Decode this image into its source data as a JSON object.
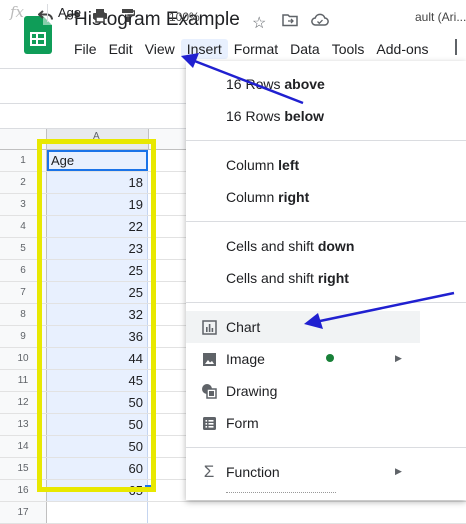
{
  "header": {
    "title": "Histogram Example",
    "menu": [
      "File",
      "Edit",
      "View",
      "Insert",
      "Format",
      "Data",
      "Tools",
      "Add-ons"
    ]
  },
  "toolbar": {
    "zoom": "100%",
    "font": "ault (Ari..."
  },
  "formula_bar": {
    "fx": "fx",
    "value": "Age"
  },
  "grid": {
    "column_header": "A",
    "rows": [
      {
        "n": "1",
        "v": "Age"
      },
      {
        "n": "2",
        "v": "18"
      },
      {
        "n": "3",
        "v": "19"
      },
      {
        "n": "4",
        "v": "22"
      },
      {
        "n": "5",
        "v": "23"
      },
      {
        "n": "6",
        "v": "25"
      },
      {
        "n": "7",
        "v": "25"
      },
      {
        "n": "8",
        "v": "32"
      },
      {
        "n": "9",
        "v": "36"
      },
      {
        "n": "10",
        "v": "44"
      },
      {
        "n": "11",
        "v": "45"
      },
      {
        "n": "12",
        "v": "50"
      },
      {
        "n": "13",
        "v": "50"
      },
      {
        "n": "14",
        "v": "50"
      },
      {
        "n": "15",
        "v": "60"
      },
      {
        "n": "16",
        "v": "65"
      },
      {
        "n": "17",
        "v": ""
      }
    ]
  },
  "insert_menu": {
    "rows_above": {
      "pre": "16 Rows ",
      "bold": "above"
    },
    "rows_below": {
      "pre": "16 Rows ",
      "bold": "below"
    },
    "column_left": {
      "pre": "Column ",
      "bold": "left"
    },
    "column_right": {
      "pre": "Column ",
      "bold": "right"
    },
    "cells_down": {
      "pre": "Cells and shift ",
      "bold": "down"
    },
    "cells_right": {
      "pre": "Cells and shift ",
      "bold": "right"
    },
    "chart": "Chart",
    "image": "Image",
    "drawing": "Drawing",
    "form": "Form",
    "function": "Function",
    "sigma": "Σ"
  },
  "colors": {
    "annotation_arrow": "#2020d0",
    "highlight_box": "#e8e800",
    "selection": "#1a73e8",
    "brand": "#0f9d58"
  }
}
